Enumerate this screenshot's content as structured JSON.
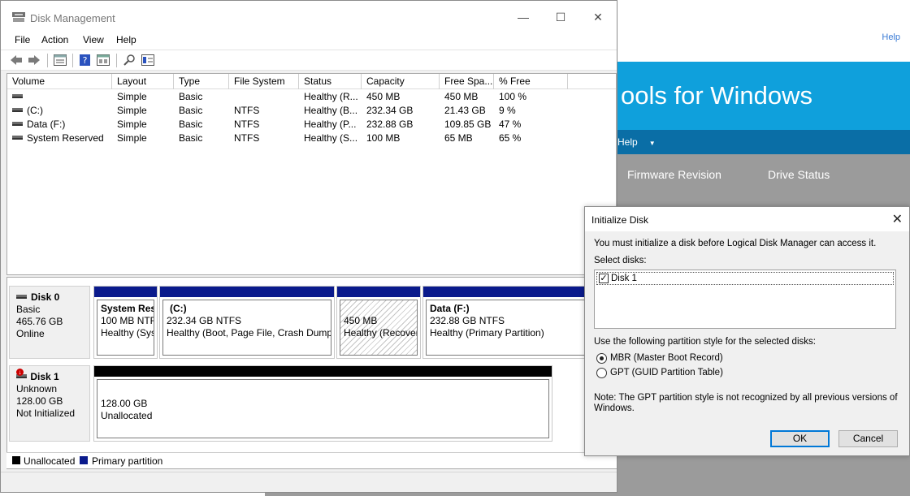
{
  "background_app": {
    "corner_text": "Help",
    "banner_title": "ools for Windows",
    "menu_item": "Help",
    "col_firmware": "Firmware Revision",
    "col_status": "Drive Status",
    "colors": {
      "banner": "#0fa0dc",
      "menu": "#0a6ea6"
    }
  },
  "disk_management": {
    "window_title": "Disk Management",
    "menu": [
      "File",
      "Action",
      "View",
      "Help"
    ],
    "toolbar_icons": [
      "back-arrow-icon",
      "forward-arrow-icon",
      "list-view-icon",
      "help-icon",
      "properties-icon",
      "rescan-icon",
      "console-tree-icon"
    ],
    "columns": [
      "Volume",
      "Layout",
      "Type",
      "File System",
      "Status",
      "Capacity",
      "Free Spa...",
      "% Free"
    ],
    "volumes": [
      {
        "volume": "",
        "layout": "Simple",
        "type": "Basic",
        "fs": "",
        "status": "Healthy (R...",
        "capacity": "450 MB",
        "free": "450 MB",
        "pct": "100 %"
      },
      {
        "volume": "(C:)",
        "layout": "Simple",
        "type": "Basic",
        "fs": "NTFS",
        "status": "Healthy (B...",
        "capacity": "232.34 GB",
        "free": "21.43 GB",
        "pct": "9 %"
      },
      {
        "volume": "Data (F:)",
        "layout": "Simple",
        "type": "Basic",
        "fs": "NTFS",
        "status": "Healthy (P...",
        "capacity": "232.88 GB",
        "free": "109.85 GB",
        "pct": "47 %"
      },
      {
        "volume": "System Reserved",
        "layout": "Simple",
        "type": "Basic",
        "fs": "NTFS",
        "status": "Healthy (S...",
        "capacity": "100 MB",
        "free": "65 MB",
        "pct": "65 %"
      }
    ],
    "disk0": {
      "name": "Disk 0",
      "type": "Basic",
      "size": "465.76 GB",
      "state": "Online",
      "partitions": [
        {
          "name": "System Res",
          "size": "100 MB NTF",
          "status": "Healthy (Sys"
        },
        {
          "name": "(C:)",
          "size": "232.34 GB NTFS",
          "status": "Healthy (Boot, Page File, Crash Dump,"
        },
        {
          "name": "",
          "size": "450 MB",
          "status": "Healthy (Recover"
        },
        {
          "name": "Data  (F:)",
          "size": "232.88 GB NTFS",
          "status": "Healthy (Primary Partition)"
        }
      ]
    },
    "disk1": {
      "name": "Disk 1",
      "type": "Unknown",
      "size": "128.00 GB",
      "state": "Not Initialized",
      "unallocated_size": "128.00 GB",
      "unallocated_label": "Unallocated"
    },
    "legend": {
      "unallocated": "Unallocated",
      "primary": "Primary partition"
    },
    "colors": {
      "primary": "#0a1a8c",
      "unallocated": "#000000"
    }
  },
  "initialize_dialog": {
    "title": "Initialize Disk",
    "intro": "You must initialize a disk before Logical Disk Manager can access it.",
    "select_label": "Select disks:",
    "disks": [
      {
        "label": "Disk 1",
        "checked": true
      }
    ],
    "style_label": "Use the following partition style for the selected disks:",
    "options": [
      {
        "label": "MBR (Master Boot Record)",
        "selected": true
      },
      {
        "label": "GPT (GUID Partition Table)",
        "selected": false
      }
    ],
    "note_line1": "Note: The GPT partition style is not recognized by all previous versions of",
    "note_line2": "Windows.",
    "ok": "OK",
    "cancel": "Cancel"
  }
}
